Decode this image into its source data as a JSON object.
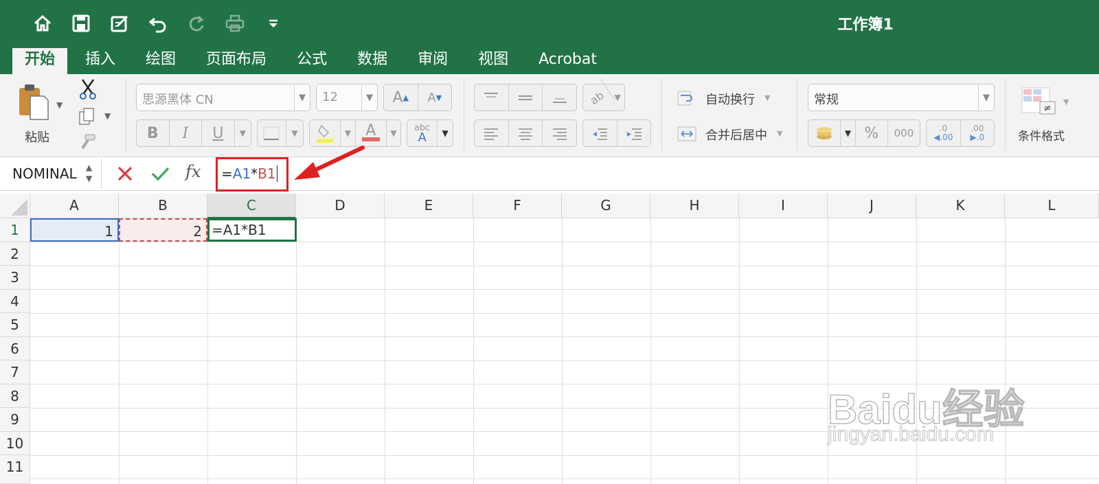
{
  "window": {
    "title": "工作簿1"
  },
  "quick_access": [
    "home-icon",
    "save-icon",
    "edit-icon",
    "undo-icon",
    "redo-icon",
    "print-icon",
    "customize-icon"
  ],
  "tabs": [
    {
      "label": "开始",
      "active": true
    },
    {
      "label": "插入"
    },
    {
      "label": "绘图"
    },
    {
      "label": "页面布局"
    },
    {
      "label": "公式"
    },
    {
      "label": "数据"
    },
    {
      "label": "审阅"
    },
    {
      "label": "视图"
    },
    {
      "label": "Acrobat"
    }
  ],
  "ribbon": {
    "paste_label": "粘贴",
    "font_name": "思源黑体 CN",
    "font_size": "12",
    "grow_font": "A",
    "shrink_font": "A",
    "bold": "B",
    "italic": "I",
    "underline": "U",
    "font_color_glyph": "A",
    "phonetic_glyph": "abc",
    "wrap_text": "自动换行",
    "merge_center": "合并后居中",
    "number_format": "常规",
    "percent": "%",
    "comma": "000",
    "increase_decimal": ".0",
    "decrease_decimal": ".00",
    "conditional_format": "条件格式",
    "accent_color": "#217346"
  },
  "formula_bar": {
    "name_box": "NOMINAL",
    "cancel_glyph": "✕",
    "enter_glyph": "✓",
    "fx": "fx",
    "formula": {
      "eq": "=",
      "ref1": "A1",
      "op": "*",
      "ref2": "B1"
    }
  },
  "sheet": {
    "columns": [
      "A",
      "B",
      "C",
      "D",
      "E",
      "F",
      "G",
      "H",
      "I",
      "J",
      "K",
      "L"
    ],
    "selected_column": "C",
    "rows": [
      "1",
      "2",
      "3",
      "4",
      "5",
      "6",
      "7",
      "8",
      "9",
      "10",
      "11"
    ],
    "cells": {
      "A1": "1",
      "B1": "2",
      "C1": "=A1*B1"
    }
  },
  "watermark": {
    "logo": "Baidu经验",
    "url": "jingyan.baidu.com"
  }
}
